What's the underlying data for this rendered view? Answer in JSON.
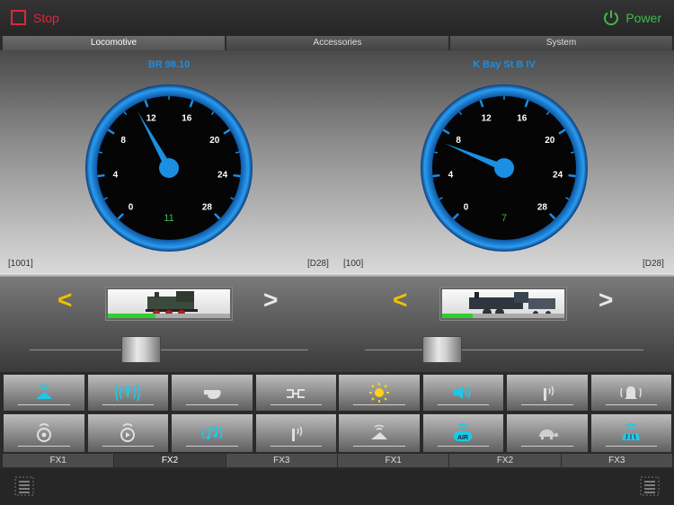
{
  "header": {
    "stop_label": "Stop",
    "power_label": "Power"
  },
  "tabs": [
    {
      "label": "Locomotive",
      "active": true
    },
    {
      "label": "Accessories",
      "active": false
    },
    {
      "label": "System",
      "active": false
    }
  ],
  "controllers": [
    {
      "name": "BR 98.10",
      "address": "[1001]",
      "decoder": "[D28]",
      "speed": 11,
      "max_speed": 28,
      "ticks": [
        "0",
        "4",
        "8",
        "12",
        "16",
        "20",
        "24",
        "28"
      ],
      "speed_fraction": 0.39,
      "prev_label": "<",
      "next_label": ">",
      "fx_icons": [
        "track-light-icon",
        "horn-signal-icon",
        "whistle-icon",
        "coupler-icon",
        "wheel-sound-icon",
        "brake-sound-icon",
        "music-note-icon",
        "antenna-icon"
      ],
      "fx_tabs": [
        {
          "label": "FX1",
          "active": false
        },
        {
          "label": "FX2",
          "active": true
        },
        {
          "label": "FX3",
          "active": false
        }
      ]
    },
    {
      "name": "K Bay St B IV",
      "address": "[100]",
      "decoder": "[D28]",
      "speed": 7,
      "max_speed": 28,
      "ticks": [
        "0",
        "4",
        "8",
        "12",
        "16",
        "20",
        "24",
        "28"
      ],
      "speed_fraction": 0.25,
      "prev_label": "<",
      "next_label": ">",
      "fx_icons": [
        "sun-icon",
        "speaker-icon",
        "antenna-icon",
        "bell-icon",
        "track-light-icon",
        "air-icon",
        "turtle-icon",
        "station-sound-icon"
      ],
      "fx_tabs": [
        {
          "label": "FX1",
          "active": false
        },
        {
          "label": "FX2",
          "active": false
        },
        {
          "label": "FX3",
          "active": false
        }
      ]
    }
  ],
  "colors": {
    "accent_blue": "#1a8fe3",
    "stop_red": "#e0253a",
    "power_green": "#3dbb4a",
    "speed_green": "#2fcf2f",
    "arrow_yellow": "#f0c000"
  }
}
